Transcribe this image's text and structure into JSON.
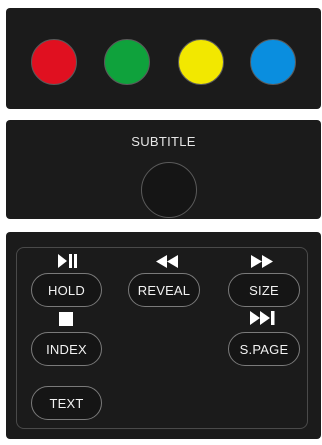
{
  "color_buttons": [
    {
      "name": "red",
      "color": "#e01020"
    },
    {
      "name": "green",
      "color": "#0fa23c"
    },
    {
      "name": "yellow",
      "color": "#f2e800"
    },
    {
      "name": "blue",
      "color": "#0a8edf"
    }
  ],
  "subtitle": {
    "label": "SUBTITLE"
  },
  "teletext": {
    "hold": {
      "label": "HOLD",
      "icon": "play-pause-icon"
    },
    "reveal": {
      "label": "REVEAL",
      "icon": "rewind-icon"
    },
    "size": {
      "label": "SIZE",
      "icon": "fast-forward-icon"
    },
    "index": {
      "label": "INDEX",
      "icon": "stop-icon"
    },
    "spage": {
      "label": "S.PAGE",
      "icon": "skip-next-icon"
    },
    "text": {
      "label": "TEXT"
    }
  }
}
